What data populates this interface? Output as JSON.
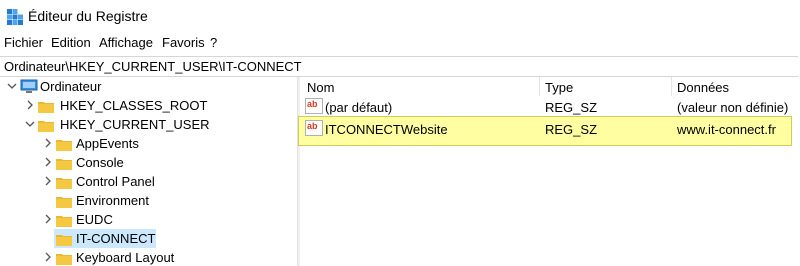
{
  "window": {
    "title": "Éditeur du Registre"
  },
  "menu": [
    "Fichier",
    "Edition",
    "Affichage",
    "Favoris",
    "?"
  ],
  "address": "Ordinateur\\HKEY_CURRENT_USER\\IT-CONNECT",
  "tree": [
    {
      "label": "Ordinateur",
      "icon": "computer-icon",
      "expanded": true
    },
    {
      "label": "HKEY_CLASSES_ROOT",
      "icon": "folder-icon",
      "expanded": false
    },
    {
      "label": "HKEY_CURRENT_USER",
      "icon": "folder-icon",
      "expanded": true
    },
    {
      "label": "AppEvents",
      "icon": "folder-icon",
      "expanded": false
    },
    {
      "label": "Console",
      "icon": "folder-icon",
      "expanded": false
    },
    {
      "label": "Control Panel",
      "icon": "folder-icon",
      "expanded": false
    },
    {
      "label": "Environment",
      "icon": "folder-icon",
      "expanded": null
    },
    {
      "label": "EUDC",
      "icon": "folder-icon",
      "expanded": false
    },
    {
      "label": "IT-CONNECT",
      "icon": "folder-icon",
      "expanded": null,
      "selected": true
    },
    {
      "label": "Keyboard Layout",
      "icon": "folder-icon",
      "expanded": false
    }
  ],
  "columns": [
    "Nom",
    "Type",
    "Données"
  ],
  "values": [
    {
      "name": "(par défaut)",
      "type": "REG_SZ",
      "data": "(valeur non définie)",
      "icon": "string-value-icon"
    },
    {
      "name": "ITCONNECTWebsite",
      "type": "REG_SZ",
      "data": "www.it-connect.fr",
      "icon": "string-value-icon",
      "highlighted": true
    }
  ],
  "colors": {
    "highlight": "#ffff99",
    "selection": "#cce8ff",
    "folder": "#e8b830"
  }
}
